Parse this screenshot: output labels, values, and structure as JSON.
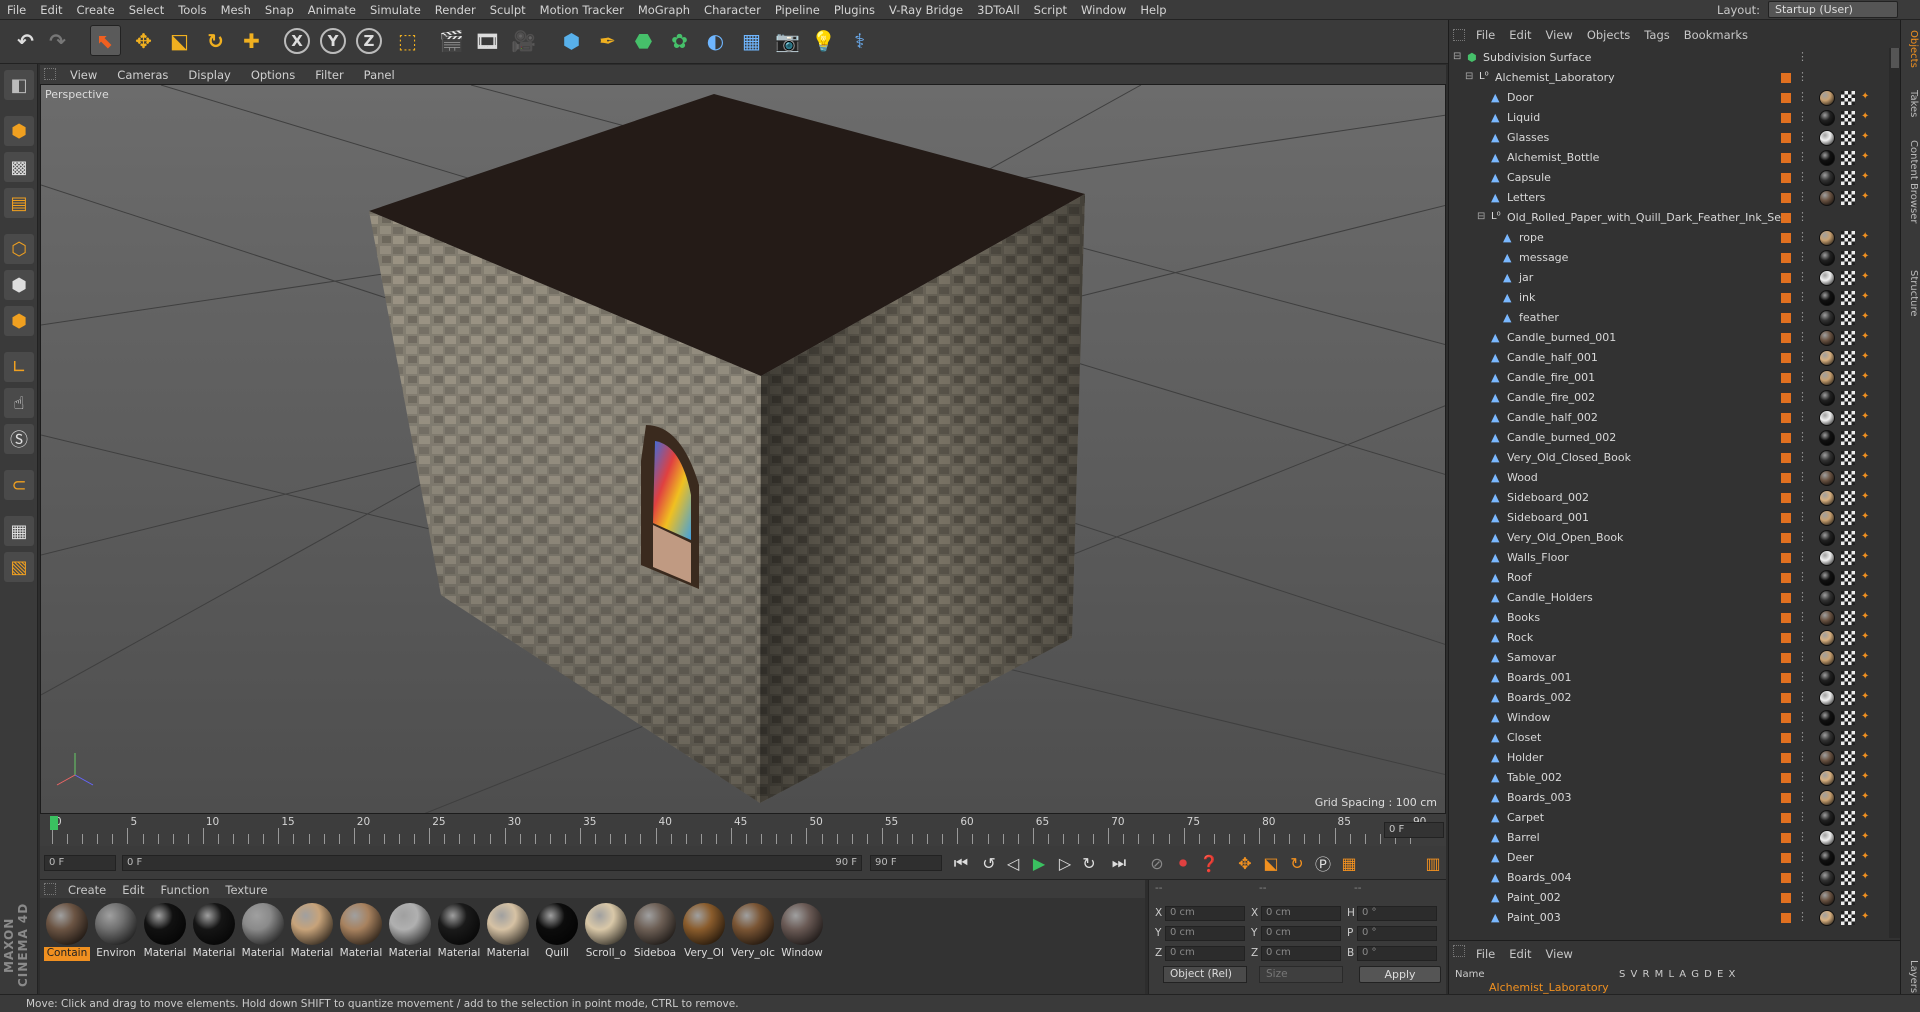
{
  "menubar": {
    "items": [
      "File",
      "Edit",
      "Create",
      "Select",
      "Tools",
      "Mesh",
      "Snap",
      "Animate",
      "Simulate",
      "Render",
      "Sculpt",
      "Motion Tracker",
      "MoGraph",
      "Character",
      "Pipeline",
      "Plugins",
      "V-Ray Bridge",
      "3DToAll",
      "Script",
      "Window",
      "Help"
    ],
    "layout_label": "Layout:",
    "layout_value": "Startup (User)"
  },
  "toolbar": {
    "axis_x": "X",
    "axis_y": "Y",
    "axis_z": "Z"
  },
  "viewport": {
    "menu": [
      "View",
      "Cameras",
      "Display",
      "Options",
      "Filter",
      "Panel"
    ],
    "label": "Perspective",
    "grid_spacing": "Grid Spacing : 100 cm"
  },
  "timeline": {
    "ticks": [
      "0",
      "5",
      "10",
      "15",
      "20",
      "25",
      "30",
      "35",
      "40",
      "45",
      "50",
      "55",
      "60",
      "65",
      "70",
      "75",
      "80",
      "85",
      "90"
    ],
    "current": "0 F",
    "start_field": "0 F",
    "range_left": "0 F",
    "range_right": "90 F",
    "end_field": "90 F"
  },
  "materials": {
    "menu": [
      "Create",
      "Edit",
      "Function",
      "Texture"
    ],
    "items": [
      {
        "name": "Contain",
        "color": "#6b5443"
      },
      {
        "name": "Environ",
        "color": "#707070"
      },
      {
        "name": "Material",
        "color": "#111111"
      },
      {
        "name": "Material",
        "color": "#151515"
      },
      {
        "name": "Material",
        "color": "#8a8a8a"
      },
      {
        "name": "Material",
        "color": "#c7a37a"
      },
      {
        "name": "Material",
        "color": "#a8825f"
      },
      {
        "name": "Material",
        "color": "#b0b0b0"
      },
      {
        "name": "Material",
        "color": "#1a1a1a"
      },
      {
        "name": "Material",
        "color": "#d6c2a4"
      },
      {
        "name": "Quill",
        "color": "#0c0c0c"
      },
      {
        "name": "Scroll_o",
        "color": "#d9c8a8"
      },
      {
        "name": "Sideboa",
        "color": "#6d5f55"
      },
      {
        "name": "Very_Ol",
        "color": "#8a5c2c"
      },
      {
        "name": "Very_olc",
        "color": "#7a5534"
      },
      {
        "name": "Window",
        "color": "#6a5a55"
      }
    ]
  },
  "coords": {
    "x_label": "X",
    "y_label": "Y",
    "z_label": "Z",
    "x2_label": "X",
    "y2_label": "Y",
    "z2_label": "Z",
    "h_label": "H",
    "p_label": "P",
    "b_label": "B",
    "pos_x": "0 cm",
    "pos_y": "0 cm",
    "pos_z": "0 cm",
    "size_x": "0 cm",
    "size_y": "0 cm",
    "size_z": "0 cm",
    "rot_h": "0 °",
    "rot_p": "0 °",
    "rot_b": "0 °",
    "mode": "Object (Rel)",
    "size_mode": "Size",
    "apply": "Apply",
    "dash1": "--",
    "dash2": "--",
    "dash3": "--"
  },
  "status": "Move: Click and drag to move elements. Hold down SHIFT to quantize movement / add to the selection in point mode, CTRL to remove.",
  "object_manager": {
    "menu": [
      "File",
      "Edit",
      "View",
      "Objects",
      "Tags",
      "Bookmarks"
    ],
    "objects": [
      {
        "name": "Subdivision Surface",
        "level": 0,
        "icon": "subdiv"
      },
      {
        "name": "Alchemist_Laboratory",
        "level": 1,
        "icon": "null"
      },
      {
        "name": "Door",
        "level": 2,
        "icon": "poly"
      },
      {
        "name": "Liquid",
        "level": 2,
        "icon": "poly"
      },
      {
        "name": "Glasses",
        "level": 2,
        "icon": "poly"
      },
      {
        "name": "Alchemist_Bottle",
        "level": 2,
        "icon": "poly"
      },
      {
        "name": "Capsule",
        "level": 2,
        "icon": "poly"
      },
      {
        "name": "Letters",
        "level": 2,
        "icon": "poly"
      },
      {
        "name": "Old_Rolled_Paper_with_Quill_Dark_Feather_Ink_Set",
        "level": 2,
        "icon": "null"
      },
      {
        "name": "rope",
        "level": 3,
        "icon": "poly"
      },
      {
        "name": "message",
        "level": 3,
        "icon": "poly"
      },
      {
        "name": "jar",
        "level": 3,
        "icon": "poly"
      },
      {
        "name": "ink",
        "level": 3,
        "icon": "poly"
      },
      {
        "name": "feather",
        "level": 3,
        "icon": "poly"
      },
      {
        "name": "Candle_burned_001",
        "level": 2,
        "icon": "poly"
      },
      {
        "name": "Candle_half_001",
        "level": 2,
        "icon": "poly"
      },
      {
        "name": "Candle_fire_001",
        "level": 2,
        "icon": "poly"
      },
      {
        "name": "Candle_fire_002",
        "level": 2,
        "icon": "poly"
      },
      {
        "name": "Candle_half_002",
        "level": 2,
        "icon": "poly"
      },
      {
        "name": "Candle_burned_002",
        "level": 2,
        "icon": "poly"
      },
      {
        "name": "Very_Old_Closed_Book",
        "level": 2,
        "icon": "poly"
      },
      {
        "name": "Wood",
        "level": 2,
        "icon": "poly"
      },
      {
        "name": "Sideboard_002",
        "level": 2,
        "icon": "poly"
      },
      {
        "name": "Sideboard_001",
        "level": 2,
        "icon": "poly"
      },
      {
        "name": "Very_Old_Open_Book",
        "level": 2,
        "icon": "poly"
      },
      {
        "name": "Walls_Floor",
        "level": 2,
        "icon": "poly"
      },
      {
        "name": "Roof",
        "level": 2,
        "icon": "poly"
      },
      {
        "name": "Candle_Holders",
        "level": 2,
        "icon": "poly"
      },
      {
        "name": "Books",
        "level": 2,
        "icon": "poly"
      },
      {
        "name": "Rock",
        "level": 2,
        "icon": "poly"
      },
      {
        "name": "Samovar",
        "level": 2,
        "icon": "poly"
      },
      {
        "name": "Boards_001",
        "level": 2,
        "icon": "poly"
      },
      {
        "name": "Boards_002",
        "level": 2,
        "icon": "poly"
      },
      {
        "name": "Window",
        "level": 2,
        "icon": "poly"
      },
      {
        "name": "Closet",
        "level": 2,
        "icon": "poly"
      },
      {
        "name": "Holder",
        "level": 2,
        "icon": "poly"
      },
      {
        "name": "Table_002",
        "level": 2,
        "icon": "poly"
      },
      {
        "name": "Boards_003",
        "level": 2,
        "icon": "poly"
      },
      {
        "name": "Carpet",
        "level": 2,
        "icon": "poly"
      },
      {
        "name": "Barrel",
        "level": 2,
        "icon": "poly"
      },
      {
        "name": "Deer",
        "level": 2,
        "icon": "poly"
      },
      {
        "name": "Boards_004",
        "level": 2,
        "icon": "poly"
      },
      {
        "name": "Paint_002",
        "level": 2,
        "icon": "poly"
      },
      {
        "name": "Paint_003",
        "level": 2,
        "icon": "poly"
      }
    ]
  },
  "side_tabs": [
    "Objects",
    "Takes",
    "Content Browser",
    "Structure"
  ],
  "layers": {
    "menu": [
      "File",
      "Edit",
      "View"
    ],
    "header_name": "Name",
    "header_cols": "S V R M L A G D E X",
    "row": "Alchemist_Laboratory",
    "side_tab": "Layers"
  },
  "colors": {
    "accent": "#f09020",
    "tag_orange": "#e07020"
  }
}
